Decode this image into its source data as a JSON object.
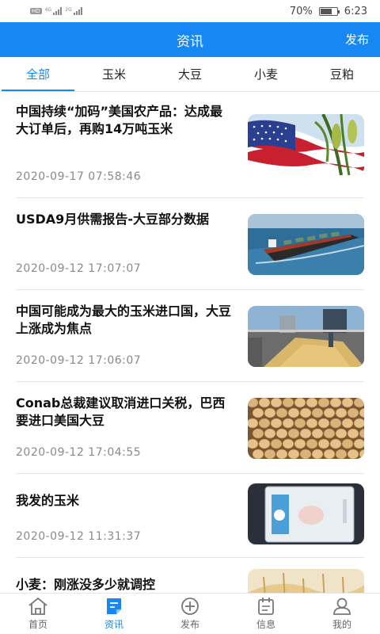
{
  "status_bar": {
    "network_left": "HD",
    "sig1_label": "4G",
    "sig2_label": "2G",
    "battery": "70%",
    "time": "6:23",
    "battery_level": 0.7
  },
  "header": {
    "title": "资讯",
    "action": "发布"
  },
  "tabs": [
    {
      "label": "全部",
      "active": true
    },
    {
      "label": "玉米",
      "active": false
    },
    {
      "label": "大豆",
      "active": false
    },
    {
      "label": "小麦",
      "active": false
    },
    {
      "label": "豆粕",
      "active": false
    }
  ],
  "news": [
    {
      "title": "中国持续“加码”美国农产品：达成最大订单后，再购14万吨玉米",
      "time": "2020-09-17 07:58:46",
      "thumb": "flag-corn-image"
    },
    {
      "title": "USDA9月供需报告-大豆部分数据",
      "time": "2020-09-12 17:07:07",
      "thumb": "cargo-ship-image"
    },
    {
      "title": "中国可能成为最大的玉米进口国，大豆上涨成为焦点",
      "time": "2020-09-12 17:06:07",
      "thumb": "grain-loading-image"
    },
    {
      "title": "Conab总裁建议取消进口关税，巴西要进口美国大豆",
      "time": "2020-09-12 17:04:55",
      "thumb": "soybeans-image"
    },
    {
      "title": "我发的玉米",
      "time": "2020-09-12 11:31:37",
      "thumb": "phone-photo-image"
    },
    {
      "title": "小麦：刚涨没多少就调控",
      "time": "",
      "thumb": "wheat-image"
    }
  ],
  "bottom_nav": [
    {
      "label": "首页",
      "icon": "home-icon",
      "active": false
    },
    {
      "label": "资讯",
      "icon": "news-icon",
      "active": true
    },
    {
      "label": "发布",
      "icon": "plus-circle-icon",
      "active": false
    },
    {
      "label": "信息",
      "icon": "calendar-icon",
      "active": false
    },
    {
      "label": "我的",
      "icon": "person-icon",
      "active": false
    }
  ],
  "colors": {
    "accent": "#1788f3",
    "text": "#111111",
    "muted": "#8a8a8a"
  }
}
